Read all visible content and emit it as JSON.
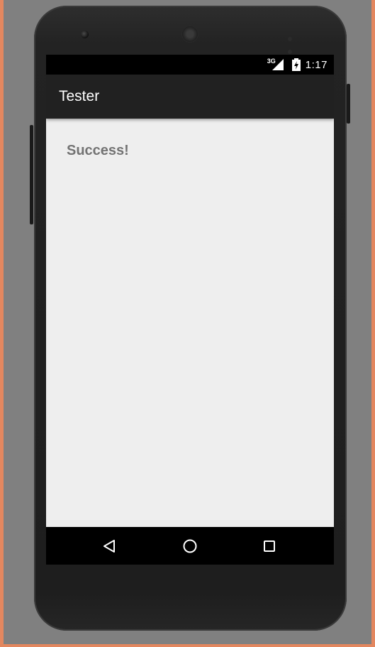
{
  "status_bar": {
    "network_type": "3G",
    "time": "1:17"
  },
  "app_bar": {
    "title": "Tester"
  },
  "content": {
    "message": "Success!"
  },
  "nav_bar": {
    "back_icon": "back-triangle-icon",
    "home_icon": "home-circle-icon",
    "recents_icon": "recents-square-icon"
  },
  "colors": {
    "app_bar_bg": "#212121",
    "content_bg": "#eeeeee",
    "message_text": "#737373",
    "frame_border": "#e3875f"
  }
}
